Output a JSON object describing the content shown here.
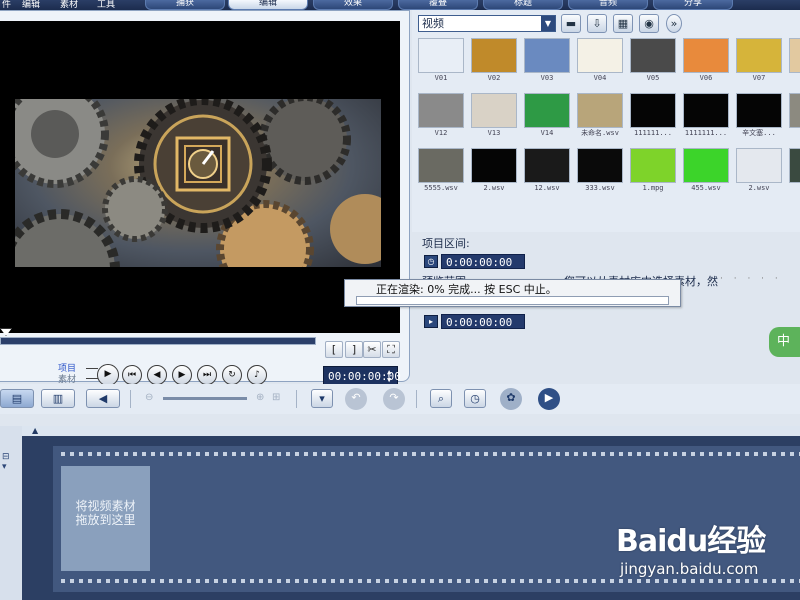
{
  "top_menu": [
    "件",
    "编辑",
    "素材",
    "工具"
  ],
  "top_tabs": [
    {
      "label": "捕获",
      "active": false
    },
    {
      "label": "编辑",
      "active": true
    },
    {
      "label": "效果",
      "active": false
    },
    {
      "label": "覆叠",
      "active": false
    },
    {
      "label": "标题",
      "active": false
    },
    {
      "label": "音频",
      "active": false
    },
    {
      "label": "分享",
      "active": false
    }
  ],
  "preview": {
    "mode_project_label": "项目",
    "mode_clip_label": "素材",
    "timecode": "00:00:00:00",
    "trim_in_label": "[",
    "trim_out_label": "]"
  },
  "library": {
    "category": "视频",
    "thumbnails": [
      {
        "caption": "V01",
        "color": "#e8eef6"
      },
      {
        "caption": "V02",
        "color": "#c08a2a"
      },
      {
        "caption": "V03",
        "color": "#6a8ac0"
      },
      {
        "caption": "V04",
        "color": "#f4f1e6"
      },
      {
        "caption": "V05",
        "color": "#4a4a4a"
      },
      {
        "caption": "V06",
        "color": "#e88a3c"
      },
      {
        "caption": "V07",
        "color": "#d6b43a"
      },
      {
        "caption": "V0",
        "color": "#e2c9a0"
      },
      {
        "caption": "V12",
        "color": "#8a8a8a"
      },
      {
        "caption": "V13",
        "color": "#d9d2c6"
      },
      {
        "caption": "V14",
        "color": "#2e9a45"
      },
      {
        "caption": "未命名.wsv",
        "color": "#b8a57a"
      },
      {
        "caption": "111111...",
        "color": "#050505"
      },
      {
        "caption": "1111111...",
        "color": "#050505"
      },
      {
        "caption": "辛文塞...",
        "color": "#050505"
      },
      {
        "caption": "",
        "color": "#8c8a80"
      },
      {
        "caption": "5555.wsv",
        "color": "#6a6a62"
      },
      {
        "caption": "2.wsv",
        "color": "#050505"
      },
      {
        "caption": "12.wsv",
        "color": "#1a1a1a"
      },
      {
        "caption": "333.wsv",
        "color": "#0a0a0a"
      },
      {
        "caption": "1.mpg",
        "color": "#7ed32a"
      },
      {
        "caption": "455.wsv",
        "color": "#3cd42a"
      },
      {
        "caption": "2.wsv",
        "color": "#e4e8ee"
      },
      {
        "caption": "",
        "color": "#3a4a40"
      }
    ]
  },
  "options": {
    "title": "项目区间:",
    "timecode_1": "0:00:00:00",
    "timecode_2": "0:00:00:00",
    "partial_text_left": "预览范围",
    "partial_text_right": "您可以从素材库中选择素材，然",
    "start_label": "中"
  },
  "render_dialog": {
    "message": "正在渲染:  0% 完成... 按 ESC 中止。",
    "progress_fraction": 0.0
  },
  "timeline": {
    "drop_hint": "将视频素材\n拖放到这里"
  },
  "watermark": {
    "logo": "Baidu经验",
    "url": "jingyan.baidu.com"
  }
}
